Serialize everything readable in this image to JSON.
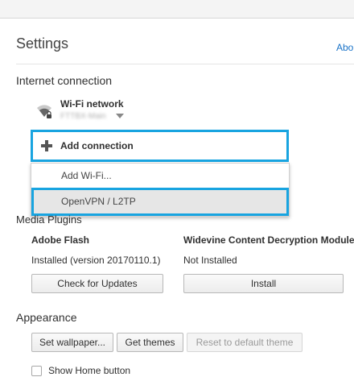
{
  "page": {
    "title": "Settings",
    "about_link": "Abo"
  },
  "internet": {
    "section_title": "Internet connection",
    "network_label": "Wi-Fi network",
    "network_status": "FTTBX-Main",
    "add_connection_label": "Add connection",
    "menu_items": [
      "Add Wi-Fi...",
      "OpenVPN / L2TP"
    ]
  },
  "media_plugins": {
    "section_title": "Media Plugins",
    "flash": {
      "name": "Adobe Flash",
      "status": "Installed (version 20170110.1)",
      "button": "Check for Updates"
    },
    "widevine": {
      "name": "Widevine Content Decryption Module",
      "status": "Not Installed",
      "button": "Install"
    }
  },
  "appearance": {
    "section_title": "Appearance",
    "set_wallpaper": "Set wallpaper...",
    "get_themes": "Get themes",
    "reset_default_theme": "Reset to default theme",
    "show_home_button": "Show Home button"
  },
  "colors": {
    "focus_ring": "#18a4e0",
    "link": "#1a73c8"
  }
}
